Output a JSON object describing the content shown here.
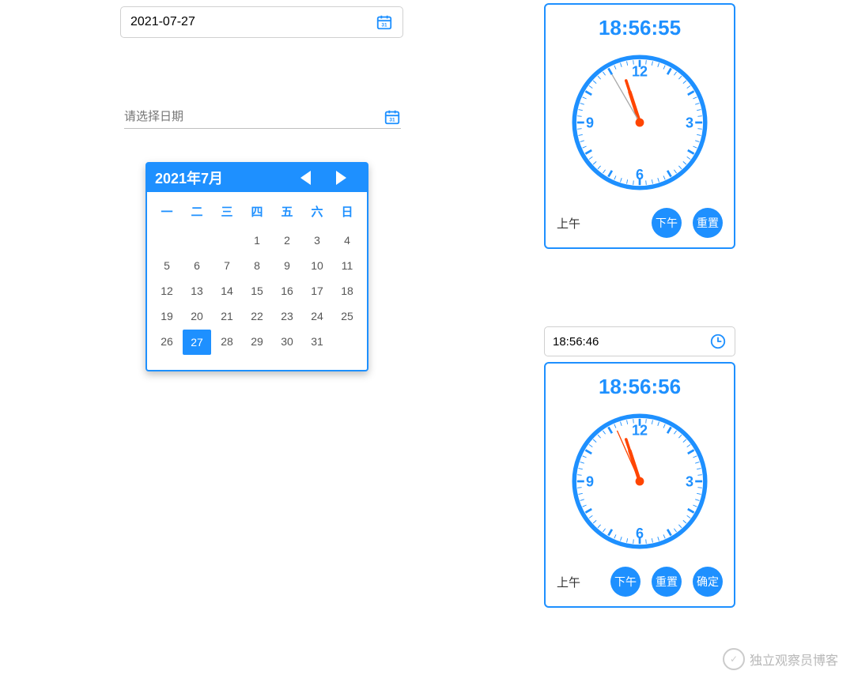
{
  "date_input_1": {
    "value": "2021-07-27"
  },
  "date_input_2": {
    "placeholder": "请选择日期"
  },
  "calendar": {
    "title": "2021年7月",
    "dow": [
      "一",
      "二",
      "三",
      "四",
      "五",
      "六",
      "日"
    ],
    "blanks": 3,
    "last_day": 31,
    "selected": 27
  },
  "clock1": {
    "time_text": "18:56:55",
    "am_label": "上午",
    "pm_label": "下午",
    "reset_label": "重置"
  },
  "time_input": {
    "value": "18:56:46"
  },
  "clock2": {
    "time_text": "18:56:56",
    "am_label": "上午",
    "pm_label": "下午",
    "reset_label": "重置",
    "ok_label": "确定"
  },
  "watermark": {
    "text": "独立观察员博客"
  }
}
